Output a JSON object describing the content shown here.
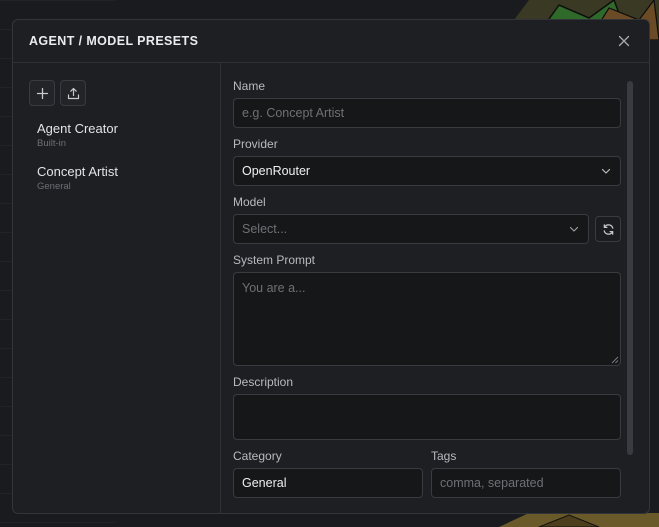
{
  "modal": {
    "title": "AGENT / MODEL PRESETS"
  },
  "sidebar": {
    "presets": [
      {
        "name": "Agent Creator",
        "category": "Built-in"
      },
      {
        "name": "Concept Artist",
        "category": "General"
      }
    ]
  },
  "form": {
    "name": {
      "label": "Name",
      "placeholder": "e.g. Concept Artist"
    },
    "provider": {
      "label": "Provider",
      "value": "OpenRouter"
    },
    "model": {
      "label": "Model",
      "placeholder": "Select..."
    },
    "system_prompt": {
      "label": "System Prompt",
      "placeholder": "You are a..."
    },
    "description": {
      "label": "Description",
      "value": ""
    },
    "category": {
      "label": "Category",
      "value": "General"
    },
    "tags": {
      "label": "Tags",
      "placeholder": "comma, separated"
    }
  },
  "icons": {
    "close": "close-icon",
    "add": "plus-icon",
    "export": "upload-icon",
    "refresh": "refresh-icon",
    "dropdown": "chevron-down-icon"
  },
  "colors": {
    "background": "#1e1f22",
    "field": "#161719",
    "border": "#3a3b40",
    "text": "#e6e6e8",
    "muted": "#6f7076"
  }
}
